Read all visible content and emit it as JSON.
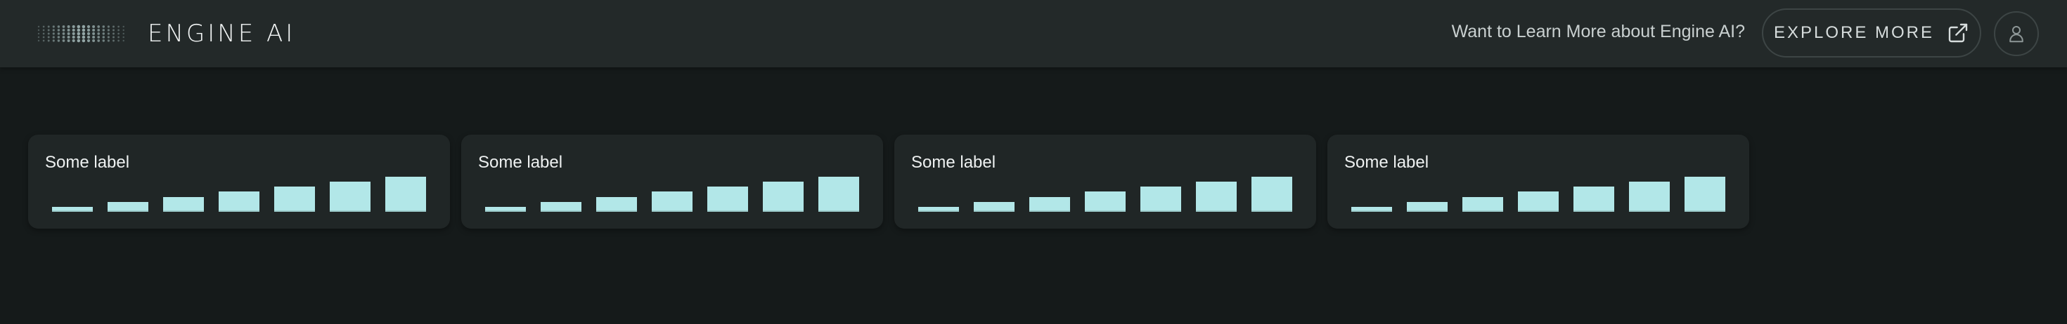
{
  "header": {
    "brand_name": "ENGINE AI",
    "logo_icon": "dots-grid-logo",
    "learn_more_text": "Want to Learn More about Engine AI?",
    "explore_label": "EXPLORE MORE",
    "explore_icon": "external-link-icon",
    "user_icon": "user-icon"
  },
  "cards": [
    {
      "label": "Some label",
      "bar_values": [
        1,
        2,
        3,
        4,
        5,
        6,
        7
      ]
    },
    {
      "label": "Some label",
      "bar_values": [
        1,
        2,
        3,
        4,
        5,
        6,
        7
      ]
    },
    {
      "label": "Some label",
      "bar_values": [
        1,
        2,
        3,
        4,
        5,
        6,
        7
      ]
    },
    {
      "label": "Some label",
      "bar_values": [
        1,
        2,
        3,
        4,
        5,
        6,
        7
      ]
    }
  ],
  "colors": {
    "background": "#151a1a",
    "header": "#232929",
    "card": "#202626",
    "bar": "#b2e7e8"
  }
}
